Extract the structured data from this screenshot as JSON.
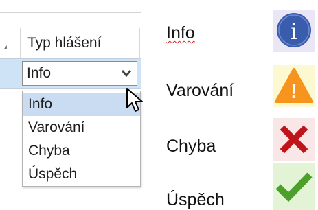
{
  "grid": {
    "column_header": "Typ hlášení",
    "editor_value": "Info",
    "dropdown_options": [
      "Info",
      "Varování",
      "Chyba",
      "Úspěch"
    ],
    "selected_option_index": 0
  },
  "legend": {
    "items": [
      {
        "label": "Info",
        "icon": "info-icon",
        "color": "#3a5cad",
        "background": "#eae6f6"
      },
      {
        "label": "Varování",
        "icon": "warning-icon",
        "color": "#f7941d",
        "background": "#fcf8cf"
      },
      {
        "label": "Chyba",
        "icon": "error-icon",
        "color": "#c0141b",
        "background": "#f9e6e6"
      },
      {
        "label": "Úspěch",
        "icon": "success-icon",
        "color": "#4aa029",
        "background": "#e3f3d6"
      }
    ]
  },
  "icons": {
    "info_glyph": "i",
    "warning_glyph": "!"
  }
}
